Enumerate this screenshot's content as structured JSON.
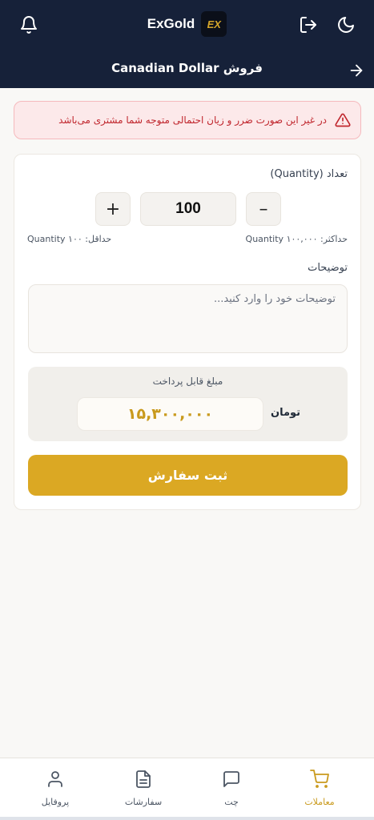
{
  "header": {
    "brand_name": "ExGold",
    "logo_text": "EX",
    "page_title": "فروش Canadian Dollar",
    "icons": [
      "bell-icon",
      "logout-icon",
      "moon-icon",
      "arrow-right-icon"
    ]
  },
  "alert": {
    "icon": "warning-triangle-icon",
    "text": "در غیر این صورت ضرر و زیان احتمالی متوجه شما مشتری می‌باشد"
  },
  "form": {
    "quantity_label": "تعداد (Quantity)",
    "quantity_value": "100",
    "plus_label": "+",
    "minus_label": "–",
    "max_text": "حداکثر: ۱۰۰,۰۰۰ Quantity",
    "min_text": "حداقل: ۱۰۰ Quantity",
    "description_label": "توضیحات",
    "description_placeholder": "توضیحات خود را وارد کنید...",
    "payable_label": "مبلغ قابل پرداخت",
    "payable_amount": "۱۵,۳۰۰,۰۰۰",
    "currency": "تومان",
    "submit_label": "ثبت سفارش"
  },
  "bottom_nav": {
    "items": [
      {
        "label": "معاملات",
        "icon": "cart-icon",
        "active": true
      },
      {
        "label": "چت",
        "icon": "chat-icon",
        "active": false
      },
      {
        "label": "سفارشات",
        "icon": "document-icon",
        "active": false
      },
      {
        "label": "پروفایل",
        "icon": "user-icon",
        "active": false
      }
    ]
  },
  "colors": {
    "header_bg": "#162139",
    "accent": "#dba823",
    "amount_text": "#c99a1d",
    "alert_bg": "#fce9ea",
    "alert_text": "#c0262d"
  }
}
